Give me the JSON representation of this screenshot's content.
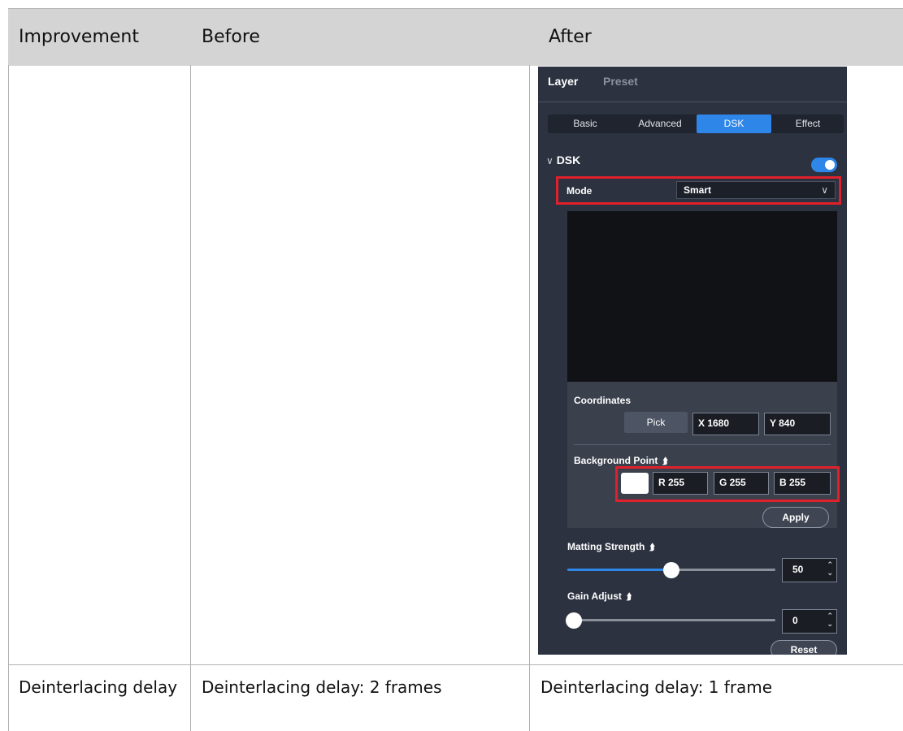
{
  "table": {
    "headers": [
      "Improvement",
      "Before",
      "After"
    ],
    "row2": {
      "improvement": "Deinterlacing delay",
      "before": "Deinterlacing delay: 2 frames",
      "after": "Deinterlacing delay: 1 frame"
    }
  },
  "panel": {
    "tabs": [
      "Layer",
      "Preset"
    ],
    "segments": [
      "Basic",
      "Advanced",
      "DSK",
      "Effect"
    ],
    "active_segment": "DSK",
    "section_title": "DSK",
    "section_chevron": "chevron-down-icon",
    "dsk_enabled": true,
    "mode_label": "Mode",
    "mode_value": "Smart",
    "coordinates_label": "Coordinates",
    "pick_label": "Pick",
    "x_value": "X 1680",
    "y_value": "Y 840",
    "background_point_label": "Background Point",
    "r_value": "R 255",
    "g_value": "G 255",
    "b_value": "B 255",
    "swatch_color": "#ffffff",
    "apply_label": "Apply",
    "matting_label": "Matting Strength",
    "matting_value": "50",
    "gain_label": "Gain Adjust",
    "gain_value": "0",
    "reset_label": "Reset",
    "colors": {
      "accent": "#2e86e8",
      "highlight": "#e0202a",
      "panel_bg": "#2c3240"
    }
  }
}
